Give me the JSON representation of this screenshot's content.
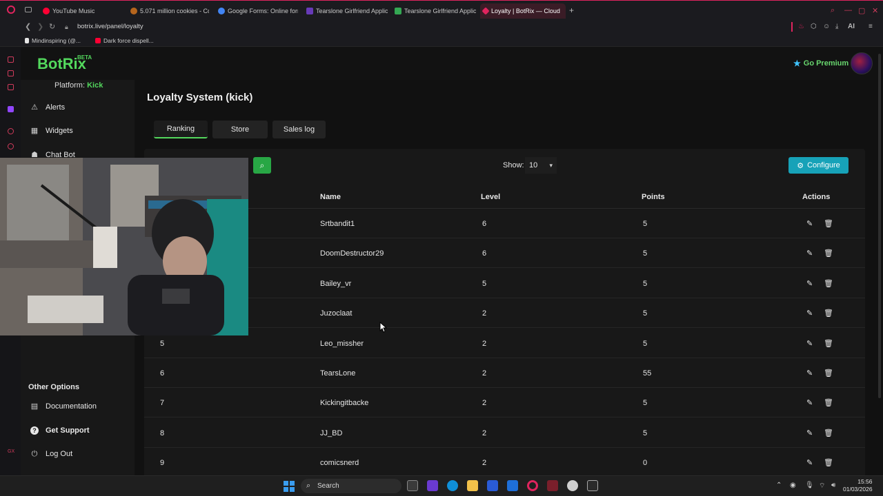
{
  "browser": {
    "tabs": [
      {
        "label": "YouTube Music",
        "color": "#ff0033"
      },
      {
        "label": "5.071 million cookies - Co",
        "color": "#b5651d"
      },
      {
        "label": "Google Forms: Online form",
        "color": "#4285f4"
      },
      {
        "label": "Tearslone Girlfriend Applic",
        "color": "#673ab7"
      },
      {
        "label": "Tearslone Girlfriend Applic",
        "color": "#34a853"
      },
      {
        "label": "Loyalty | BotRix — Cloud",
        "color": "#e0245e"
      }
    ],
    "url": "botrix.live/panel/loyalty",
    "extensions_label": "AI",
    "bookmarks": [
      {
        "label": "Mindinspiring (@...",
        "color": "#e6e6e6"
      },
      {
        "label": "Dark force dispell...",
        "color": "#ff0033"
      }
    ]
  },
  "app": {
    "logo": "BotRix",
    "beta": "BETA",
    "premium": "Go Premium",
    "platform_label": "Platform:",
    "platform_value": "Kick",
    "nav": [
      {
        "label": "Alerts",
        "icon": "warning-icon"
      },
      {
        "label": "Widgets",
        "icon": "grid-icon"
      },
      {
        "label": "Chat Bot",
        "icon": "robot-icon"
      }
    ],
    "other_heading": "Other Options",
    "other_nav": [
      {
        "label": "Documentation",
        "icon": "document-icon"
      },
      {
        "label": "Get Support",
        "icon": "help-icon"
      },
      {
        "label": "Log Out",
        "icon": "logout-icon"
      }
    ]
  },
  "main": {
    "title": "Loyalty System (kick)",
    "tabs": [
      "Ranking",
      "Store",
      "Sales log"
    ],
    "show_label": "Show:",
    "show_value": "10",
    "configure": "Configure",
    "columns": [
      "Name",
      "Level",
      "Points",
      "Actions"
    ],
    "rows": [
      {
        "rank": "",
        "name": "Srtbandit1",
        "level": "6",
        "points": "5"
      },
      {
        "rank": "",
        "name": "DoomDestructor29",
        "level": "6",
        "points": "5"
      },
      {
        "rank": "",
        "name": "Bailey_vr",
        "level": "5",
        "points": "5"
      },
      {
        "rank": "",
        "name": "Juzoclaat",
        "level": "2",
        "points": "5"
      },
      {
        "rank": "5",
        "name": "Leo_missher",
        "level": "2",
        "points": "5"
      },
      {
        "rank": "6",
        "name": "TearsLone",
        "level": "2",
        "points": "55"
      },
      {
        "rank": "7",
        "name": "Kickingitbacke",
        "level": "2",
        "points": "5"
      },
      {
        "rank": "8",
        "name": "JJ_BD",
        "level": "2",
        "points": "5"
      },
      {
        "rank": "9",
        "name": "comicsnerd",
        "level": "2",
        "points": "0"
      }
    ]
  },
  "taskbar": {
    "search_label": "Search",
    "time": "15:56",
    "date": "01/03/2026"
  },
  "colors": {
    "accent_green": "#53d85d",
    "configure_teal": "#17a2b8",
    "search_green": "#28a745",
    "browser_accent": "#e0245e"
  }
}
